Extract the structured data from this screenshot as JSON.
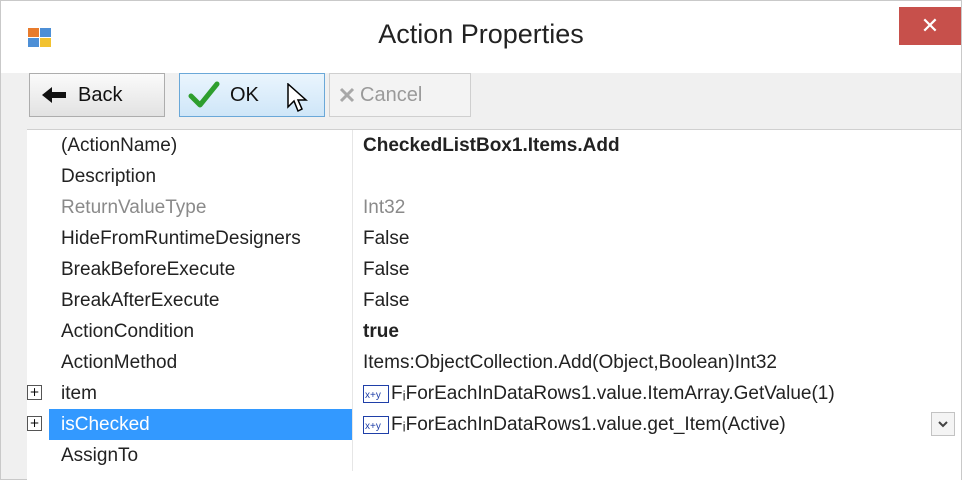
{
  "window": {
    "title": "Action Properties",
    "close_glyph": "✕"
  },
  "toolbar": {
    "back_label": "Back",
    "ok_label": "OK",
    "cancel_label": "Cancel"
  },
  "properties": [
    {
      "name": "(ActionName)",
      "value": "CheckedListBox1.Items.Add"
    },
    {
      "name": "Description",
      "value": ""
    },
    {
      "name": "ReturnValueType",
      "value": "Int32"
    },
    {
      "name": "HideFromRuntimeDesigners",
      "value": "False"
    },
    {
      "name": "BreakBeforeExecute",
      "value": "False"
    },
    {
      "name": "BreakAfterExecute",
      "value": "False"
    },
    {
      "name": "ActionCondition",
      "value": "true"
    },
    {
      "name": "ActionMethod",
      "value": "Items:ObjectCollection.Add(Object,Boolean)Int32"
    },
    {
      "name": "item",
      "value": "ForEachInDataRows1.value.ItemArray.GetValue(1)",
      "value_prefix": "Fᵢ"
    },
    {
      "name": "isChecked",
      "value": "ForEachInDataRows1.value.get_Item(Active)",
      "value_prefix": "Fᵢ"
    },
    {
      "name": "AssignTo",
      "value": ""
    }
  ],
  "colors": {
    "selection": "#3399ff",
    "close_button": "#c7504b"
  },
  "icons": {
    "app": "app-icon",
    "back": "back-arrow-icon",
    "ok": "checkmark-icon",
    "cancel": "cancel-x-icon",
    "cursor": "mouse-cursor-icon",
    "expression": "math-expression-icon",
    "dropdown": "chevron-down-icon"
  }
}
